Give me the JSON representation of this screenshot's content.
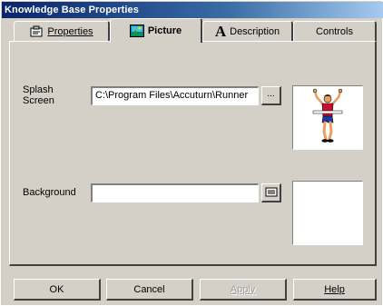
{
  "window": {
    "title": "Knowledge Base Properties"
  },
  "tabs": [
    {
      "label": "Properties",
      "icon": "properties-icon",
      "active": false
    },
    {
      "label": "Picture",
      "icon": "picture-icon",
      "active": true
    },
    {
      "label": "Description",
      "icon": "description-icon",
      "active": false
    },
    {
      "label": "Controls",
      "icon": "",
      "active": false
    }
  ],
  "picture_tab": {
    "splash_label_line1": "Splash",
    "splash_label_line2": "Screen",
    "splash_value": "C:\\Program Files\\Accuturn\\Runner",
    "browse_label": "...",
    "background_label": "Background",
    "background_value": "",
    "background_browse_icon": "folder-icon",
    "splash_preview_icon": "runner-icon"
  },
  "buttons": {
    "ok": "OK",
    "cancel": "Cancel",
    "apply": "Apply",
    "help": "Help"
  }
}
